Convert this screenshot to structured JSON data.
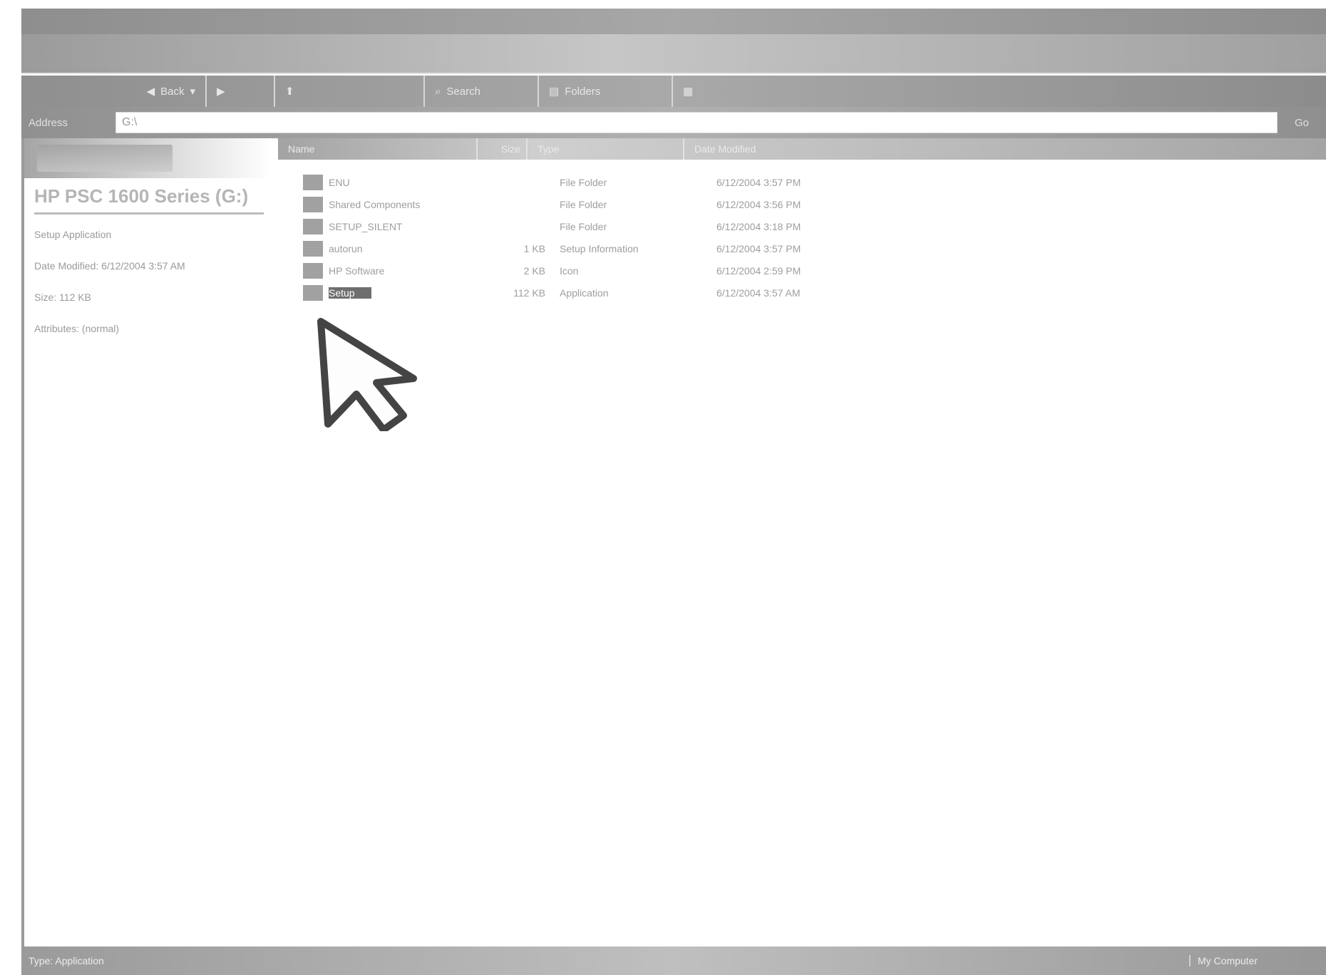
{
  "window": {
    "title": ""
  },
  "menu": {
    "items": []
  },
  "toolbar": {
    "back": "Back",
    "forward": "",
    "up": "",
    "search": "Search",
    "folders": "Folders",
    "views": ""
  },
  "address": {
    "label": "Address",
    "value": "G:\\",
    "go": "Go"
  },
  "left_pane": {
    "title": "HP PSC 1600 Series (G:)",
    "details": [
      "Setup Application",
      "Date Modified: 6/12/2004 3:57 AM",
      "Size: 112 KB",
      "Attributes: (normal)"
    ]
  },
  "columns": {
    "name": "Name",
    "size": "Size",
    "type": "Type",
    "modified": "Date Modified"
  },
  "files": [
    {
      "name": "ENU",
      "size": "",
      "type": "File Folder",
      "modified": "6/12/2004 3:57 PM",
      "selected": false
    },
    {
      "name": "Shared Components",
      "size": "",
      "type": "File Folder",
      "modified": "6/12/2004 3:56 PM",
      "selected": false
    },
    {
      "name": "SETUP_SILENT",
      "size": "",
      "type": "File Folder",
      "modified": "6/12/2004 3:18 PM",
      "selected": false
    },
    {
      "name": "autorun",
      "size": "1 KB",
      "type": "Setup Information",
      "modified": "6/12/2004 3:57 PM",
      "selected": false
    },
    {
      "name": "HP Software",
      "size": "2 KB",
      "type": "Icon",
      "modified": "6/12/2004 2:59 PM",
      "selected": false
    },
    {
      "name": "Setup",
      "size": "112 KB",
      "type": "Application",
      "modified": "6/12/2004 3:57 AM",
      "selected": true
    }
  ],
  "status": {
    "text": "Type: Application",
    "size": "",
    "zone": "My Computer"
  }
}
